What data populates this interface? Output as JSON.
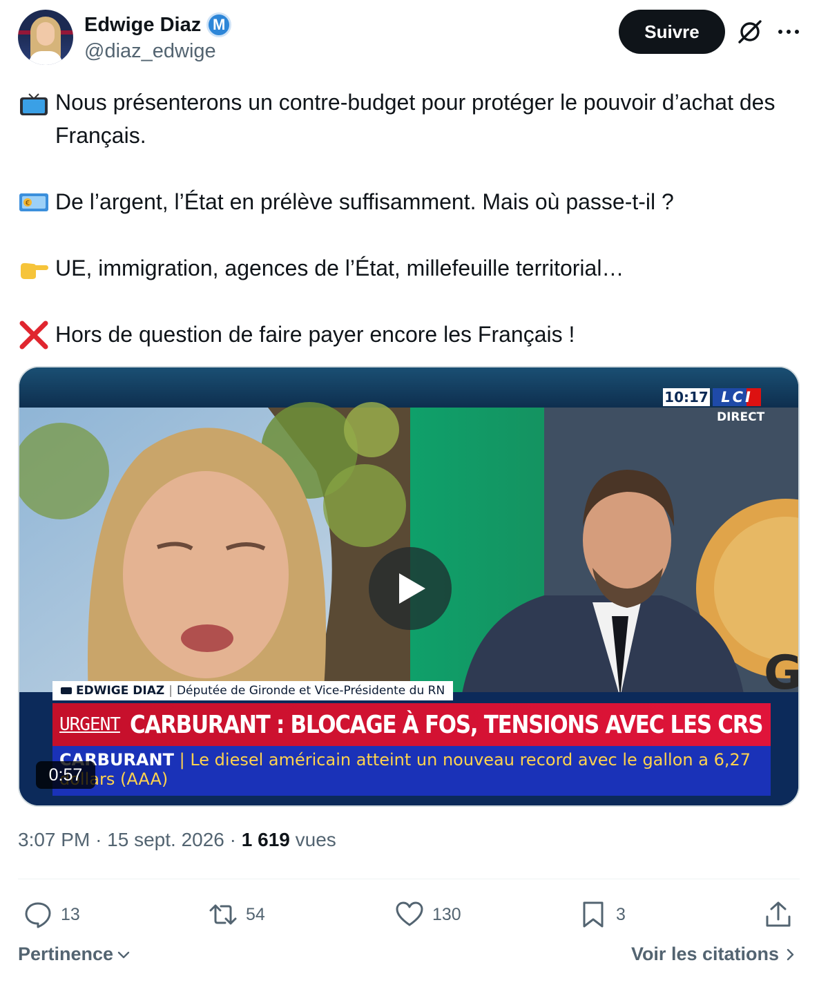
{
  "author": {
    "display_name": "Edwige Diaz",
    "verified_badge": "M",
    "handle": "@diaz_edwige"
  },
  "header": {
    "follow_label": "Suivre",
    "icons": [
      "grok-icon",
      "more-icon"
    ]
  },
  "tweet": {
    "paragraphs": [
      {
        "emoji": "television-emoji",
        "text": "Nous présenterons un contre-budget pour protéger le pouvoir d’achat des Français."
      },
      {
        "emoji": "euro-banknote-emoji",
        "text": "De l’argent, l’État en prélève suffisamment. Mais où passe-t-il ?"
      },
      {
        "emoji": "pointing-right-emoji",
        "text": "UE, immigration, agences de l’État, millefeuille territorial…"
      },
      {
        "emoji": "cross-mark-emoji",
        "text": "Hors de question de faire payer encore les Français !"
      }
    ]
  },
  "video": {
    "duration": "0:57",
    "overlay": {
      "clock": "10:17",
      "channel": "LCI",
      "live": "DIRECT",
      "guest_name": "EDWIGE DIAZ",
      "guest_title": "Députée de Gironde et Vice-Présidente du RN",
      "urgent": "URGENT",
      "headline": "CARBURANT : BLOCAGE À FOS, TENSIONS AVEC LES CRS",
      "ticker_tag": "CARBURANT",
      "ticker_text": "Le diesel américain atteint un nouveau record avec le gallon a 6,27 dollars (AAA)",
      "studio_letter": "G"
    }
  },
  "meta": {
    "time": "3:07 PM",
    "dot": "·",
    "date": "15 sept. 2026",
    "views_count": "1 619",
    "views_label": "vues"
  },
  "actions": {
    "replies": "13",
    "reposts": "54",
    "likes": "130",
    "bookmarks": "3"
  },
  "footer": {
    "sort_label": "Pertinence",
    "quotes_label": "Voir les citations"
  },
  "colors": {
    "text": "#0f1419",
    "secondary": "#536471",
    "follow_bg": "#0f1419",
    "verified": "#2d86d8"
  }
}
